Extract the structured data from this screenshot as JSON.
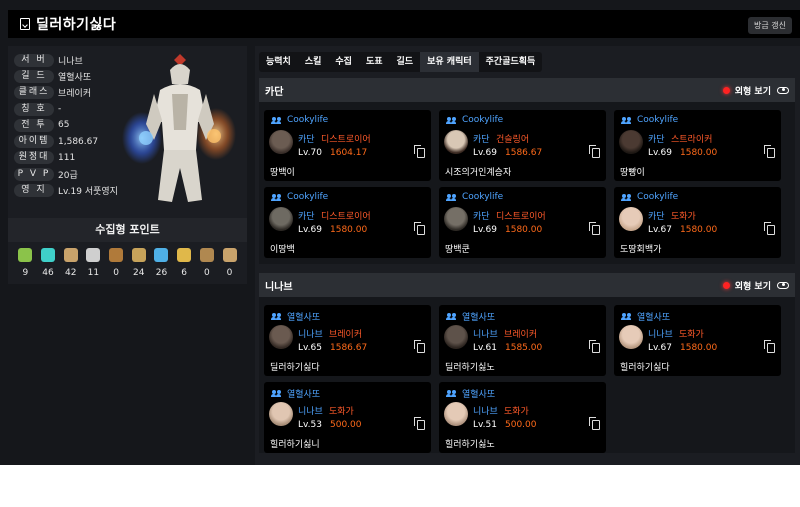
{
  "header": {
    "title": "딜러하기싫다",
    "refresh_label": "방금 갱신"
  },
  "profile": {
    "rows": [
      {
        "label": "서 버",
        "value": "니나브"
      },
      {
        "label": "길 드",
        "value": "열혈사또"
      },
      {
        "label": "클래스",
        "value": "브레이커"
      },
      {
        "label": "칭 호",
        "value": "-"
      },
      {
        "label": "전 투",
        "value": "65"
      },
      {
        "label": "아이템",
        "value": "1,586.67"
      },
      {
        "label": "원정대",
        "value": "111"
      },
      {
        "label": "P V P",
        "value": "20급"
      },
      {
        "label": "영 지",
        "value": "Lv.19 서풋영지"
      }
    ]
  },
  "collect": {
    "title": "수집형 포인트",
    "items": [
      {
        "icon": "mokoko-seed-icon",
        "color": "#8bc34a",
        "value": "9"
      },
      {
        "icon": "island-soul-icon",
        "color": "#3fd0c9",
        "value": "46"
      },
      {
        "icon": "giant-heart-icon",
        "color": "#c9a36b",
        "value": "42"
      },
      {
        "icon": "ignea-token-icon",
        "color": "#cfcfcf",
        "value": "11"
      },
      {
        "icon": "art-icon",
        "color": "#b07a3a",
        "value": "0"
      },
      {
        "icon": "voyage-icon",
        "color": "#c7a35a",
        "value": "24"
      },
      {
        "icon": "world-tree-leaf-icon",
        "color": "#4fb0e6",
        "value": "26"
      },
      {
        "icon": "orpheus-star-icon",
        "color": "#e0b84a",
        "value": "6"
      },
      {
        "icon": "orchestra-icon",
        "color": "#b08850",
        "value": "0"
      },
      {
        "icon": "sea-bounty-icon",
        "color": "#c9a36b",
        "value": "0"
      }
    ]
  },
  "tabs": [
    "능력치",
    "스킬",
    "수집",
    "도표",
    "길드",
    "보유 캐릭터",
    "주간골드획득"
  ],
  "look_label": "외형 보기",
  "sections": [
    {
      "name": "카단",
      "cards": [
        {
          "guild": "Cookylife",
          "server": "카단",
          "class": "디스트로이어",
          "lv": "Lv.70",
          "ilv": "1604.17",
          "name": "땅백이"
        },
        {
          "guild": "Cookylife",
          "server": "카단",
          "class": "건슬링어",
          "lv": "Lv.69",
          "ilv": "1586.67",
          "name": "시조의거인계승자"
        },
        {
          "guild": "Cookylife",
          "server": "카단",
          "class": "스트라이커",
          "lv": "Lv.69",
          "ilv": "1580.00",
          "name": "땅빵이"
        },
        {
          "guild": "Cookylife",
          "server": "카단",
          "class": "디스트로이어",
          "lv": "Lv.69",
          "ilv": "1580.00",
          "name": "이땅백"
        },
        {
          "guild": "Cookylife",
          "server": "카단",
          "class": "디스트로이어",
          "lv": "Lv.69",
          "ilv": "1580.00",
          "name": "땅백쿤"
        },
        {
          "guild": "Cookylife",
          "server": "카단",
          "class": "도화가",
          "lv": "Lv.67",
          "ilv": "1580.00",
          "name": "도땅회백가"
        }
      ]
    },
    {
      "name": "니나브",
      "cards": [
        {
          "guild": "열혈사또",
          "server": "니나브",
          "class": "브레이커",
          "lv": "Lv.65",
          "ilv": "1586.67",
          "name": "딜러하기싫다"
        },
        {
          "guild": "열혈사또",
          "server": "니나브",
          "class": "브레이커",
          "lv": "Lv.61",
          "ilv": "1585.00",
          "name": "딜러하기싫노"
        },
        {
          "guild": "열혈사또",
          "server": "니나브",
          "class": "도화가",
          "lv": "Lv.67",
          "ilv": "1580.00",
          "name": "힐러하기싫다"
        },
        {
          "guild": "열혈사또",
          "server": "니나브",
          "class": "도화가",
          "lv": "Lv.53",
          "ilv": "500.00",
          "name": "힐러하기싫니"
        },
        {
          "guild": "열혈사또",
          "server": "니나브",
          "class": "도화가",
          "lv": "Lv.51",
          "ilv": "500.00",
          "name": "힐러하기싫노"
        }
      ]
    }
  ]
}
